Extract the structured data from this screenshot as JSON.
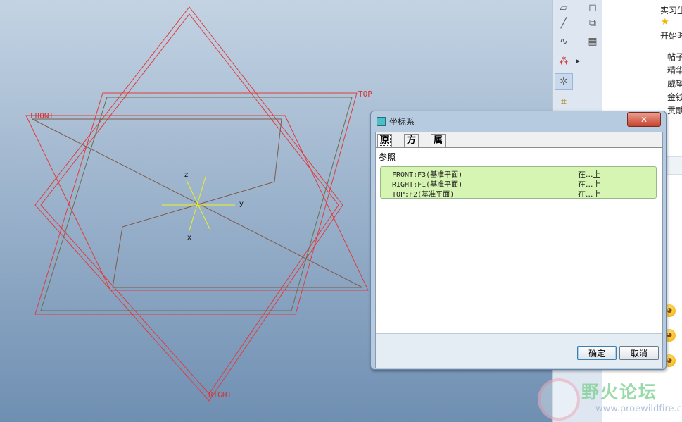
{
  "viewport": {
    "datums": {
      "front": "FRONT",
      "top": "TOP",
      "right": "RIGHT"
    },
    "axes": {
      "z": "z",
      "y": "y",
      "x": "x"
    },
    "colors": {
      "datum": "#e03c3c",
      "axis": "#f0f020"
    }
  },
  "dialog": {
    "title": "坐标系",
    "close": "✕",
    "tabs": [
      "原点",
      "方向",
      "属性"
    ],
    "references_label": "参照",
    "references": [
      {
        "name": "FRONT:F3(基准平面)",
        "type": "在...上"
      },
      {
        "name": "RIGHT:F1(基准平面)",
        "type": "在...上"
      },
      {
        "name": "TOP:F2(基准平面)",
        "type": "在...上"
      }
    ],
    "ok": "确定",
    "cancel": "取消",
    "list_color": "#d7f5b2"
  },
  "toolbar": {
    "icons": [
      "plane-icon",
      "line-icon",
      "curve-icon",
      "point-icon",
      "coordinate-system-icon",
      "offset-icon",
      "sketch-icon",
      "cube-icon",
      "grid-icon"
    ]
  },
  "right_panel": {
    "lines": [
      "实习生",
      "开始时",
      "帖子",
      "精华",
      "威望",
      "金钱",
      "贡献"
    ]
  },
  "watermark": {
    "title": "野火论坛",
    "url": "www.proewildfire.cn"
  }
}
